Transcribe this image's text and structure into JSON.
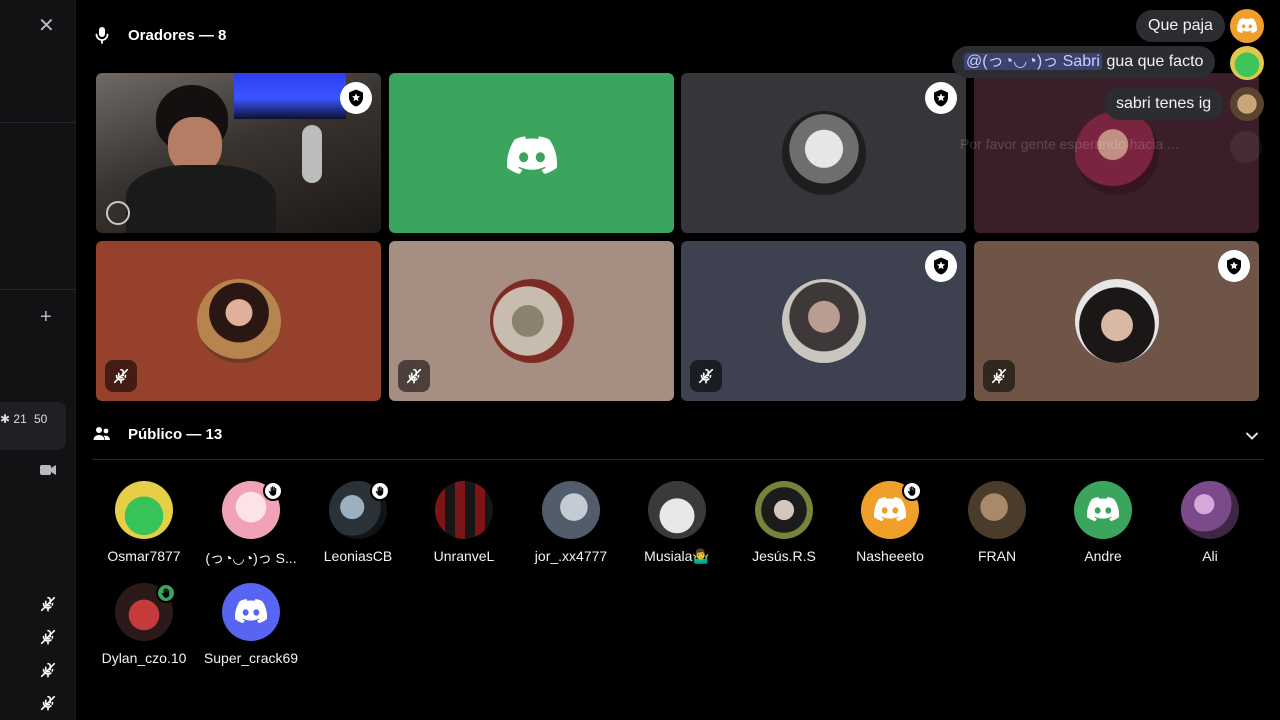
{
  "stage": {
    "speakers_header": "Oradores — 8",
    "audience_header": "Público — 13"
  },
  "rail": {
    "count_a": "21",
    "count_b": "50"
  },
  "colors": {
    "discord_green": "#3ba55d",
    "discord_blurple": "#5865f2",
    "discord_orange": "#f0a02a"
  },
  "chat": {
    "messages": [
      {
        "text": "Que paja"
      },
      {
        "mention": "@(っ◔◡◔)っ Sabri",
        "text": " gua que facto"
      },
      {
        "text": "sabri tenes ig"
      },
      {
        "text": "Por favor gente esperando hacia ..."
      }
    ]
  },
  "audience": [
    {
      "name": "Osmar7877",
      "icon": "green-alien-avatar",
      "hand": false
    },
    {
      "name": "(っ◔◡◔)っ S...",
      "icon": "anime-girl-avatar",
      "hand": true
    },
    {
      "name": "LeoniasCB",
      "icon": "photo-avatar",
      "hand": true
    },
    {
      "name": "UnranveL",
      "icon": "jersey-avatar",
      "hand": false
    },
    {
      "name": "jor_.xx4777",
      "icon": "photo-avatar",
      "hand": false
    },
    {
      "name": "Musiala🤷‍♂",
      "icon": "soccer-player-avatar",
      "hand": false
    },
    {
      "name": "Jesús.R.S",
      "icon": "photo-avatar",
      "hand": false
    },
    {
      "name": "Nasheeeto",
      "icon": "discord-logo-icon",
      "hand": true
    },
    {
      "name": "FRAN",
      "icon": "photo-avatar",
      "hand": false
    },
    {
      "name": "Andre",
      "icon": "discord-logo-icon",
      "hand": false
    },
    {
      "name": "Ali",
      "icon": "photo-avatar",
      "hand": false
    },
    {
      "name": "Dylan_czo.10",
      "icon": "photo-avatar",
      "hand": false
    },
    {
      "name": "Super_crack69",
      "icon": "discord-logo-icon",
      "hand": false
    }
  ]
}
